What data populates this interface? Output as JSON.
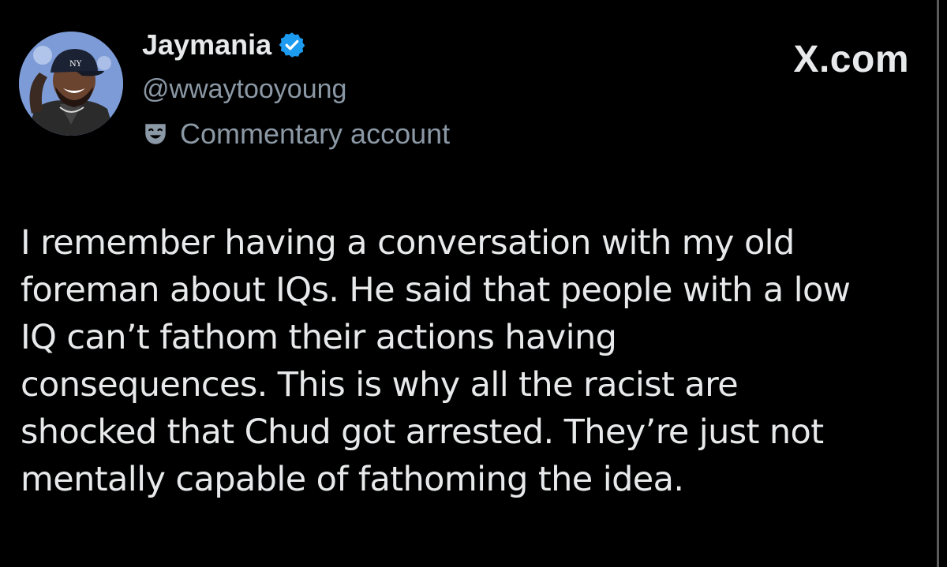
{
  "header": {
    "display_name": "Jaymania",
    "handle": "@wwaytooyoung",
    "account_label": "Commentary account",
    "source": "X.com"
  },
  "icons": {
    "avatar": "cartoon-avatar-icon",
    "verified": "verified-badge-icon",
    "account_type": "theater-mask-icon"
  },
  "colors": {
    "background": "#000000",
    "primary_text": "#e7e9ea",
    "secondary_text": "#8b98a5",
    "verified_badge": "#1d9bf0"
  },
  "tweet": {
    "lines": [
      "I remember having a conversation with my old",
      "foreman about IQs. He said that people with a low",
      "IQ can’t fathom their actions having",
      "consequences. This is why all the racist are",
      "shocked that Chud got arrested. They’re just not",
      "mentally capable of fathoming the idea."
    ]
  }
}
